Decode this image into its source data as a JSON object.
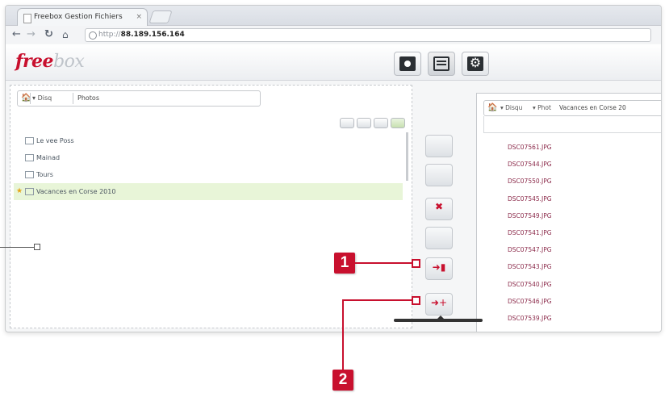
{
  "browser": {
    "tab_title": "Freebox Gestion Fichiers",
    "tab_close": "×",
    "url_protocol": "http://",
    "url_host": "88.189.156.164"
  },
  "app": {
    "logo_main": "free",
    "logo_sub": "box"
  },
  "left_panel": {
    "crumb_root": "Disq",
    "crumb_current": "Photos",
    "folders": [
      {
        "label": "Le vee Poss",
        "selected": false
      },
      {
        "label": "Mainad",
        "selected": false
      },
      {
        "label": "Tours",
        "selected": false
      },
      {
        "label": "Vacances en Corse 2010",
        "selected": true
      }
    ]
  },
  "right_panel": {
    "crumb_a": "Disqu",
    "crumb_b": "Phot",
    "crumb_c": "Vacances en Corse 20",
    "files": [
      "DSC07561.JPG",
      "DSC07544.JPG",
      "DSC07550.JPG",
      "DSC07545.JPG",
      "DSC07549.JPG",
      "DSC07541.JPG",
      "DSC07547.JPG",
      "DSC07543.JPG",
      "DSC07540.JPG",
      "DSC07546.JPG",
      "DSC07539.JPG"
    ]
  },
  "callouts": {
    "one": "1",
    "two": "2"
  },
  "colors": {
    "accent": "#c8102e",
    "selected_row": "#e8f5d8",
    "file_text": "#8b2a4a"
  }
}
